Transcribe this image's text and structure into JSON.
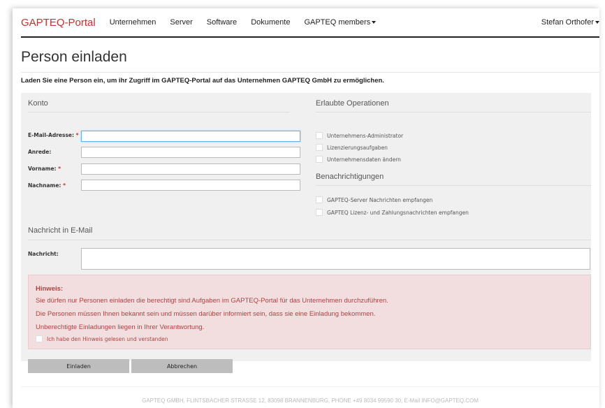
{
  "navbar": {
    "brand": "GAPTEQ-Portal",
    "items": [
      "Unternehmen",
      "Server",
      "Software",
      "Dokumente"
    ],
    "dropdown": "GAPTEQ members",
    "user": "Stefan Orthofer"
  },
  "page": {
    "title": "Person einladen",
    "intro": "Laden Sie eine Person ein, um ihr Zugriff im GAPTEQ-Portal auf das Unternehmen GAPTEQ GmbH zu ermöglichen."
  },
  "account": {
    "section_title": "Konto",
    "fields": [
      {
        "label": "E-Mail-Adresse:",
        "required": "*",
        "value": ""
      },
      {
        "label": "Anrede:",
        "required": "",
        "value": ""
      },
      {
        "label": "Vorname:",
        "required": "*",
        "value": ""
      },
      {
        "label": "Nachname:",
        "required": "*",
        "value": ""
      }
    ]
  },
  "operations": {
    "section_title": "Erlaubte Operationen",
    "items": [
      "Unternehmens-Administrator",
      "Lizenzierungsaufgaben",
      "Unternehmensdaten ändern"
    ]
  },
  "notifications": {
    "section_title": "Benachrichtigungen",
    "items": [
      "GAPTEQ-Server Nachrichten empfangen",
      "GAPTEQ Lizenz- und Zahlungsnachrichten empfangen"
    ]
  },
  "message": {
    "section_title": "Nachricht in E-Mail",
    "label": "Nachricht:",
    "value": ""
  },
  "alert": {
    "title": "Hinweis:",
    "lines": [
      "Sie dürfen nur Personen einladen die berechtigt sind Aufgaben im GAPTEQ-Portal für das Unternehmen durchzuführen.",
      "Die Personen müssen Ihnen bekannt sein und müssen darüber informiert sein, dass sie eine Einladung bekommen.",
      "Unberechtigte Einladungen liegen in Ihrer Verantwortung."
    ],
    "checkbox_label": "Ich habe den Hinweis gelesen und verstanden"
  },
  "buttons": {
    "invite": "Einladen",
    "cancel": "Abbrechen"
  },
  "footer": "GAPTEQ GMBH, FLINTSBACHER STRASSE 12, 83098 BRANNENBURG, PHONE +49 8034 99590 30, E-Mail INFO@GAPTEQ.COM",
  "colors": {
    "brand": "#c9302c",
    "alert_bg": "#f2dede",
    "alert_text": "#a94442",
    "panel_bg": "#f0f0f0",
    "button_bg": "#bdbdbd"
  }
}
